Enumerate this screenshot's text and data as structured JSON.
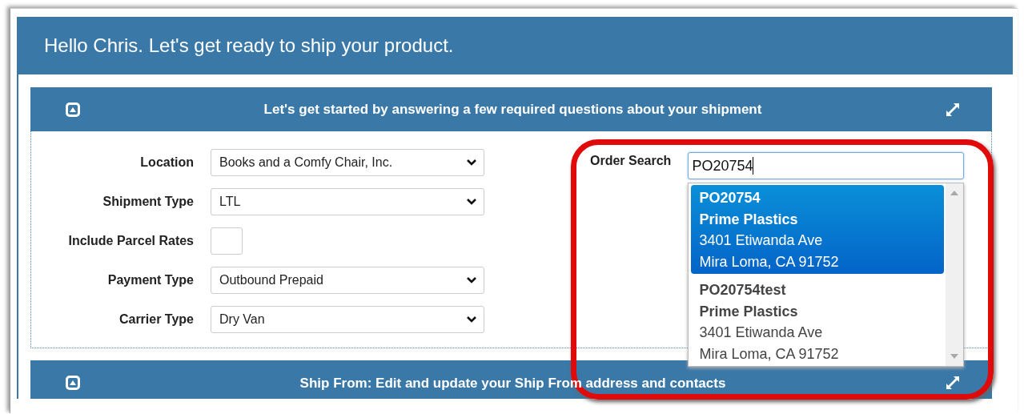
{
  "greeting": "Hello Chris. Let's get ready to ship your product.",
  "sections": [
    {
      "kind": "form",
      "title": "Let's get started by answering a few required questions about your shipment"
    },
    {
      "kind": "header",
      "title": "Ship From: Edit and update your Ship From address and contacts"
    }
  ],
  "form": {
    "fields": [
      {
        "kind": "select",
        "label": "Location",
        "value": "Books and a Comfy Chair, Inc."
      },
      {
        "kind": "select",
        "label": "Shipment Type",
        "value": "LTL"
      },
      {
        "kind": "checkbox",
        "label": "Include Parcel Rates",
        "checked": false
      },
      {
        "kind": "select",
        "label": "Payment Type",
        "value": "Outbound Prepaid"
      },
      {
        "kind": "select",
        "label": "Carrier Type",
        "value": "Dry Van"
      }
    ]
  },
  "order_search": {
    "label": "Order Search",
    "value": "PO20754",
    "suggestions": [
      {
        "lines": [
          "PO20754",
          "Prime Plastics",
          "3401 Etiwanda Ave",
          "Mira Loma, CA 91752"
        ],
        "selected": true
      },
      {
        "lines": [
          "PO20754test",
          "Prime Plastics",
          "3401 Etiwanda Ave",
          "Mira Loma, CA 91752"
        ],
        "selected": false
      }
    ]
  },
  "highlight": {
    "kind": "ring"
  }
}
